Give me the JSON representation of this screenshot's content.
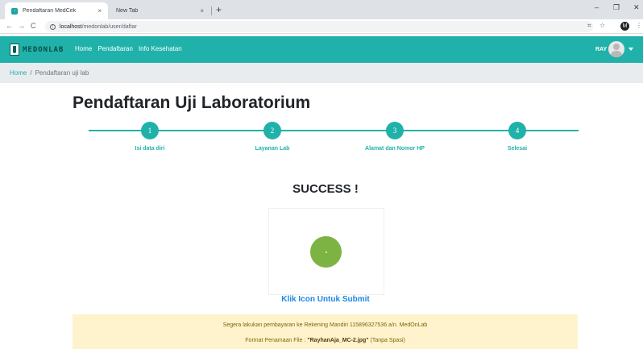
{
  "browser": {
    "tabs": [
      {
        "title": "Pendaftaran MedCek",
        "close": "×"
      },
      {
        "title": "New Tab",
        "close": "×"
      }
    ],
    "new_tab": "+",
    "window_controls": {
      "minimize": "–",
      "maximize": "❐",
      "close": "✕"
    },
    "nav": {
      "back": "←",
      "forward": "→",
      "reload": "C"
    },
    "url": {
      "host": "localhost",
      "path": "/medonlab/user/daftar"
    },
    "profile_initial": "M",
    "extensions": {
      "translate": "⌗",
      "star": "☆",
      "menu": "⋮"
    }
  },
  "navbar": {
    "brand": "MEDONLAB",
    "links": [
      "Home",
      "Pendaftaran",
      "Info Kesehatan"
    ],
    "user": "RAY"
  },
  "breadcrumb": {
    "home": "Home",
    "separator": "/",
    "current": "Pendaftaran uji lab"
  },
  "page": {
    "title": "Pendaftaran Uji Laboratorium",
    "steps": [
      {
        "number": "1",
        "label": "Isi data diri"
      },
      {
        "number": "2",
        "label": "Layanan Lab"
      },
      {
        "number": "3",
        "label": "Alamat dan Nomor HP"
      },
      {
        "number": "4",
        "label": "Selesai"
      }
    ],
    "success": "SUCCESS !",
    "submit_link": "Klik Icon Untuk Submit"
  },
  "alert": {
    "line1": "Segera lakukan pembayaran ke Rekening Mandiri 115896327536 a/n. MedOnLab",
    "line2_prefix": "Format Penamaan File : ",
    "line2_file": "\"RayhanAja_MC-2.jpg\"",
    "line2_suffix": " (Tanpa Spasi)"
  },
  "colors": {
    "accent": "#20b2aa",
    "submit_icon": "#7cb342",
    "link": "#1e88e5",
    "alert_bg": "#fff3cd"
  }
}
